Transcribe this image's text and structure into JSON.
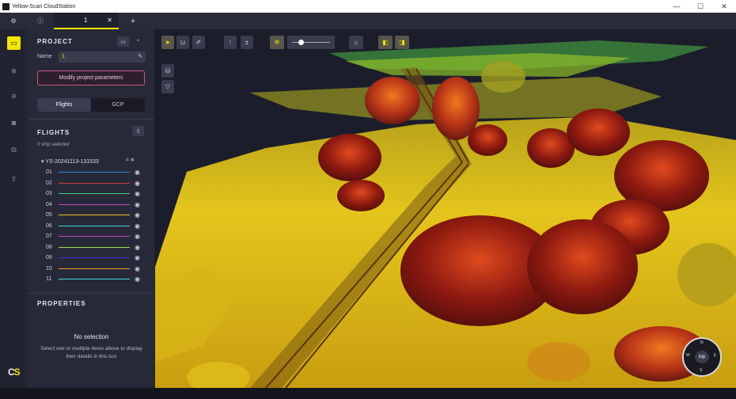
{
  "window": {
    "title": "Yellow-Scan CloudStation",
    "controls": [
      "—",
      "☐",
      "✕"
    ]
  },
  "tabs": {
    "settings_icon": "gear-icon",
    "info_icon": "info-icon",
    "active_tab": "1",
    "close": "✕",
    "add": "+"
  },
  "sidebar_rail": {
    "items": [
      "folder-icon",
      "sun-icon",
      "layers-icon",
      "camera-icon",
      "copy-icon",
      "upload-icon"
    ],
    "logo": {
      "c": "C",
      "s": "S"
    }
  },
  "project": {
    "header": "PROJECT",
    "name_label": "Name",
    "name_value": "1",
    "modify_button": "Modify project parameters",
    "segment": {
      "flights": "Flights",
      "gcp": "GCP"
    }
  },
  "flights": {
    "header": "FLIGHTS",
    "selected_text": "0 strip selected",
    "group_name": "YS-20241113-131533",
    "strips": [
      {
        "num": "01",
        "color": "#2f86d6"
      },
      {
        "num": "02",
        "color": "#d33a3a"
      },
      {
        "num": "03",
        "color": "#3ccf8e"
      },
      {
        "num": "04",
        "color": "#c641c6"
      },
      {
        "num": "05",
        "color": "#e2c128"
      },
      {
        "num": "06",
        "color": "#3fd0d0"
      },
      {
        "num": "07",
        "color": "#c641c6"
      },
      {
        "num": "08",
        "color": "#9be14c"
      },
      {
        "num": "09",
        "color": "#3a3ad6"
      },
      {
        "num": "10",
        "color": "#f0a020"
      },
      {
        "num": "11",
        "color": "#41d6e0"
      }
    ]
  },
  "properties": {
    "header": "PROPERTIES",
    "no_selection": "No selection",
    "hint": "Select one or multiple items above to display their details in this box"
  },
  "compass": {
    "label": "top",
    "letters": [
      "N",
      "E",
      "S",
      "W"
    ]
  }
}
